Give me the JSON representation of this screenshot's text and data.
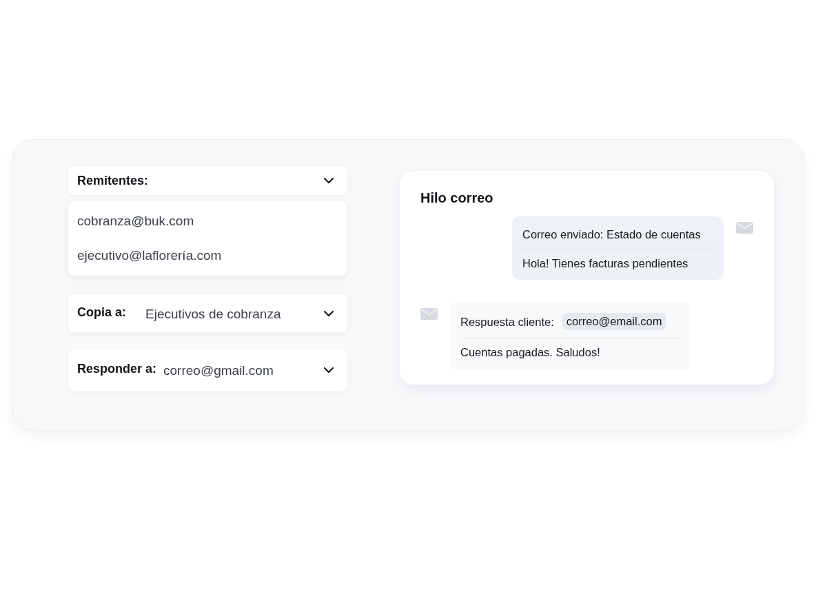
{
  "senders": {
    "label": "Remitentes:",
    "items": [
      "cobranza@buk.com",
      "ejecutivo@laflorería.com"
    ]
  },
  "fields": [
    {
      "label": "Copia a:",
      "value": "Ejecutivos de cobranza"
    },
    {
      "label": "Responder a:",
      "value": "correo@gmail.com"
    }
  ],
  "thread": {
    "title": "Hilo correo",
    "messages": [
      {
        "kind": "sent",
        "heading": "Correo enviado: Estado de cuentas",
        "body": "Hola! Tienes facturas pendientes"
      },
      {
        "kind": "received",
        "heading": "Respuesta cliente:",
        "address": "correo@email.com",
        "body": "Cuentas pagadas. Saludos!"
      }
    ]
  }
}
